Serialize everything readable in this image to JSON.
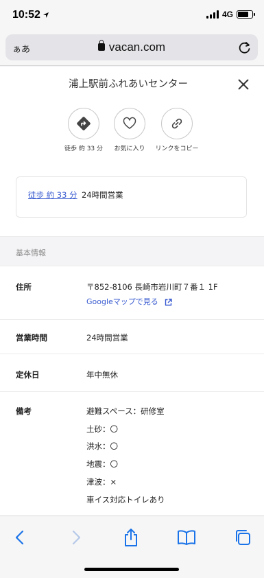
{
  "status_bar": {
    "time": "10:52",
    "network": "4G"
  },
  "browser": {
    "text_size_label": "ぁあ",
    "url": "vacan.com"
  },
  "page": {
    "title": "浦上駅前ふれあいセンター",
    "actions": [
      {
        "icon": "directions-icon",
        "label": "徒歩 約 33 分"
      },
      {
        "icon": "heart-icon",
        "label": "お気に入り"
      },
      {
        "icon": "link-icon",
        "label": "リンクをコピー"
      }
    ],
    "summary": {
      "walk_link": "徒歩 約 33 分",
      "hours": "24時間営業"
    },
    "basic_info": {
      "section_title": "基本情報",
      "address_label": "住所",
      "address": "〒852-8106 長崎市岩川町７番１ 1F",
      "map_link": "Googleマップで見る",
      "hours_label": "営業時間",
      "hours": "24時間営業",
      "closed_label": "定休日",
      "closed": "年中無休",
      "notes_label": "備考",
      "notes": [
        "避難スペース：研修室",
        "土砂：〇",
        "洪水：〇",
        "地震：〇",
        "津波：×",
        "車イス対応トイレあり"
      ]
    }
  },
  "colors": {
    "link": "#3a5cd0",
    "toolbar_icon": "#1a73e8",
    "toolbar_icon_disabled": "#b5c8e8"
  }
}
